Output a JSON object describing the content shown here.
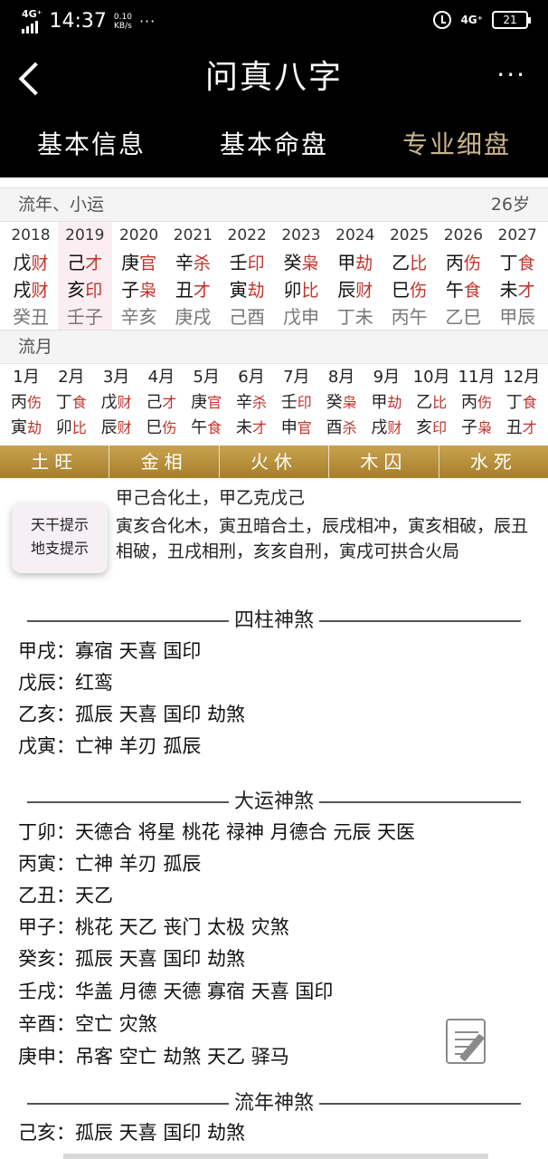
{
  "status_bar": {
    "network": "4G⁺",
    "time": "14:37",
    "speed_value": "0.10",
    "speed_unit": "KB/s",
    "dots": "···",
    "network_right": "4G⁺",
    "battery": "21"
  },
  "header": {
    "title": "问真八字",
    "more": "···"
  },
  "tabs": [
    {
      "label": "基本信息"
    },
    {
      "label": "基本命盘"
    },
    {
      "label": "专业细盘"
    }
  ],
  "liunian": {
    "title": "流年、小运",
    "age": "26岁",
    "years": [
      {
        "year": "2018",
        "g1": "戊",
        "s1": "财",
        "g2": "戌",
        "s2": "财",
        "xiaoyun": "癸丑"
      },
      {
        "year": "2019",
        "g1": "己",
        "s1": "才",
        "g2": "亥",
        "s2": "印",
        "xiaoyun": "壬子"
      },
      {
        "year": "2020",
        "g1": "庚",
        "s1": "官",
        "g2": "子",
        "s2": "枭",
        "xiaoyun": "辛亥"
      },
      {
        "year": "2021",
        "g1": "辛",
        "s1": "杀",
        "g2": "丑",
        "s2": "才",
        "xiaoyun": "庚戌"
      },
      {
        "year": "2022",
        "g1": "壬",
        "s1": "印",
        "g2": "寅",
        "s2": "劫",
        "xiaoyun": "己酉"
      },
      {
        "year": "2023",
        "g1": "癸",
        "s1": "枭",
        "g2": "卯",
        "s2": "比",
        "xiaoyun": "戊申"
      },
      {
        "year": "2024",
        "g1": "甲",
        "s1": "劫",
        "g2": "辰",
        "s2": "财",
        "xiaoyun": "丁未"
      },
      {
        "year": "2025",
        "g1": "乙",
        "s1": "比",
        "g2": "巳",
        "s2": "伤",
        "xiaoyun": "丙午"
      },
      {
        "year": "2026",
        "g1": "丙",
        "s1": "伤",
        "g2": "午",
        "s2": "食",
        "xiaoyun": "乙巳"
      },
      {
        "year": "2027",
        "g1": "丁",
        "s1": "食",
        "g2": "未",
        "s2": "才",
        "xiaoyun": "甲辰"
      }
    ]
  },
  "liuyue": {
    "title": "流月",
    "months": [
      {
        "month": "1月",
        "g1": "丙",
        "s1": "伤",
        "g2": "寅",
        "s2": "劫"
      },
      {
        "month": "2月",
        "g1": "丁",
        "s1": "食",
        "g2": "卯",
        "s2": "比"
      },
      {
        "month": "3月",
        "g1": "戊",
        "s1": "财",
        "g2": "辰",
        "s2": "财"
      },
      {
        "month": "4月",
        "g1": "己",
        "s1": "才",
        "g2": "巳",
        "s2": "伤"
      },
      {
        "month": "5月",
        "g1": "庚",
        "s1": "官",
        "g2": "午",
        "s2": "食"
      },
      {
        "month": "6月",
        "g1": "辛",
        "s1": "杀",
        "g2": "未",
        "s2": "才"
      },
      {
        "month": "7月",
        "g1": "壬",
        "s1": "印",
        "g2": "申",
        "s2": "官"
      },
      {
        "month": "8月",
        "g1": "癸",
        "s1": "枭",
        "g2": "酉",
        "s2": "杀"
      },
      {
        "month": "9月",
        "g1": "甲",
        "s1": "劫",
        "g2": "戌",
        "s2": "财"
      },
      {
        "month": "10月",
        "g1": "乙",
        "s1": "比",
        "g2": "亥",
        "s2": "印"
      },
      {
        "month": "11月",
        "g1": "丙",
        "s1": "伤",
        "g2": "子",
        "s2": "枭"
      },
      {
        "month": "12月",
        "g1": "丁",
        "s1": "食",
        "g2": "丑",
        "s2": "才"
      }
    ]
  },
  "wuxing": [
    "土旺",
    "金相",
    "火休",
    "木囚",
    "水死"
  ],
  "hints": {
    "button_line1": "天干提示",
    "button_line2": "地支提示",
    "tiangan": "甲己合化土，甲乙克戊己",
    "dizhi": "寅亥合化木，寅丑暗合土，辰戌相冲，寅亥相破，辰丑相破，丑戌相刑，亥亥自刑，寅戌可拱合火局"
  },
  "sizhu": {
    "title": "四柱神煞",
    "rows": [
      "甲戌：寡宿 天喜 国印",
      "戊辰：红鸾",
      "乙亥：孤辰 天喜 国印 劫煞",
      "戊寅：亡神 羊刃 孤辰"
    ]
  },
  "dayun": {
    "title": "大运神煞",
    "rows": [
      "丁卯：天德合 将星 桃花 禄神 月德合 元辰 天医",
      "丙寅：亡神 羊刃 孤辰",
      "乙丑：天乙",
      "甲子：桃花 天乙 丧门 太极 灾煞",
      "癸亥：孤辰 天喜 国印 劫煞",
      "壬戌：华盖 月德 天德 寡宿 天喜 国印",
      "辛酉：空亡 灾煞",
      "庚申：吊客 空亡 劫煞 天乙 驿马"
    ]
  },
  "liunian_sha": {
    "title": "流年神煞",
    "rows": [
      "己亥：孤辰 天喜 国印 劫煞"
    ]
  }
}
